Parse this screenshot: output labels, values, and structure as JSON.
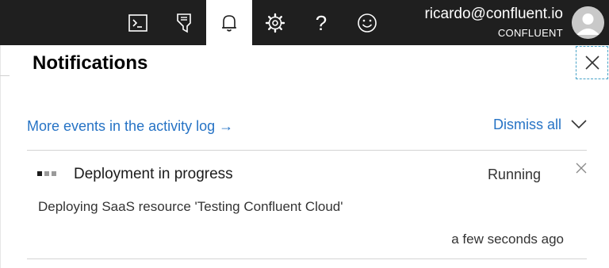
{
  "topbar": {
    "icons": [
      "cloud-shell-icon",
      "directory-filter-icon",
      "notifications-icon",
      "settings-icon",
      "help-icon",
      "feedback-icon"
    ],
    "help_glyph": "?",
    "account": {
      "email": "ricardo@confluent.io",
      "tenant": "CONFLUENT"
    }
  },
  "panel": {
    "title": "Notifications",
    "activity_link": "More events in the activity log →",
    "dismiss_label": "Dismiss all"
  },
  "notification": {
    "title": "Deployment in progress",
    "status": "Running",
    "description": "Deploying SaaS resource 'Testing Confluent Cloud'",
    "time": "a few seconds ago"
  },
  "colors": {
    "topbar_bg": "#1f1f1f",
    "link": "#2673c5",
    "divider": "#d4d4d4"
  }
}
